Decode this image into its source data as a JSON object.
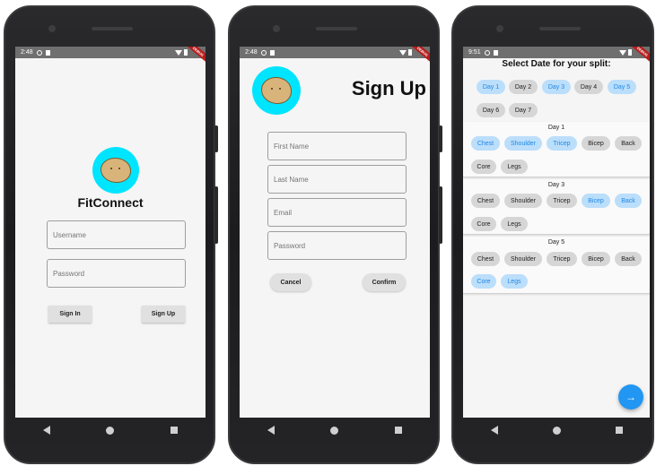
{
  "statusbar": {
    "time1": "2:48",
    "time2": "2:48",
    "time3": "9:51"
  },
  "login": {
    "app_title": "FitConnect",
    "username_placeholder": "Username",
    "password_placeholder": "Password",
    "signin_label": "Sign In",
    "signup_label": "Sign Up"
  },
  "signup": {
    "title": "Sign Up",
    "first_name": "First Name",
    "last_name": "Last Name",
    "email": "Email",
    "password": "Password",
    "cancel_label": "Cancel",
    "confirm_label": "Confirm"
  },
  "split": {
    "title": "Select Date for your split:",
    "days": [
      {
        "label": "Day 1",
        "selected": true
      },
      {
        "label": "Day 2",
        "selected": false
      },
      {
        "label": "Day 3",
        "selected": true
      },
      {
        "label": "Day 4",
        "selected": false
      },
      {
        "label": "Day 5",
        "selected": true
      },
      {
        "label": "Day 6",
        "selected": false
      },
      {
        "label": "Day 7",
        "selected": false
      }
    ],
    "cards": [
      {
        "title": "Day 1",
        "muscles": [
          {
            "label": "Chest",
            "selected": true
          },
          {
            "label": "Shoulder",
            "selected": true
          },
          {
            "label": "Tricep",
            "selected": true
          },
          {
            "label": "Bicep",
            "selected": false
          },
          {
            "label": "Back",
            "selected": false
          },
          {
            "label": "Core",
            "selected": false
          },
          {
            "label": "Legs",
            "selected": false
          }
        ]
      },
      {
        "title": "Day 3",
        "muscles": [
          {
            "label": "Chest",
            "selected": false
          },
          {
            "label": "Shoulder",
            "selected": false
          },
          {
            "label": "Tricep",
            "selected": false
          },
          {
            "label": "Bicep",
            "selected": true
          },
          {
            "label": "Back",
            "selected": true
          },
          {
            "label": "Core",
            "selected": false
          },
          {
            "label": "Legs",
            "selected": false
          }
        ]
      },
      {
        "title": "Day 5",
        "muscles": [
          {
            "label": "Chest",
            "selected": false
          },
          {
            "label": "Shoulder",
            "selected": false
          },
          {
            "label": "Tricep",
            "selected": false
          },
          {
            "label": "Bicep",
            "selected": false
          },
          {
            "label": "Back",
            "selected": false
          },
          {
            "label": "Core",
            "selected": true
          },
          {
            "label": "Legs",
            "selected": true
          }
        ]
      }
    ],
    "fab_icon": "arrow-right-icon"
  },
  "colors": {
    "accent": "#2196f3",
    "avatar_bg": "#00e5ff",
    "chip_selected": "#bbdefb",
    "chip_selected_text": "#1e88e5",
    "chip_unselected": "#d6d6d6"
  }
}
